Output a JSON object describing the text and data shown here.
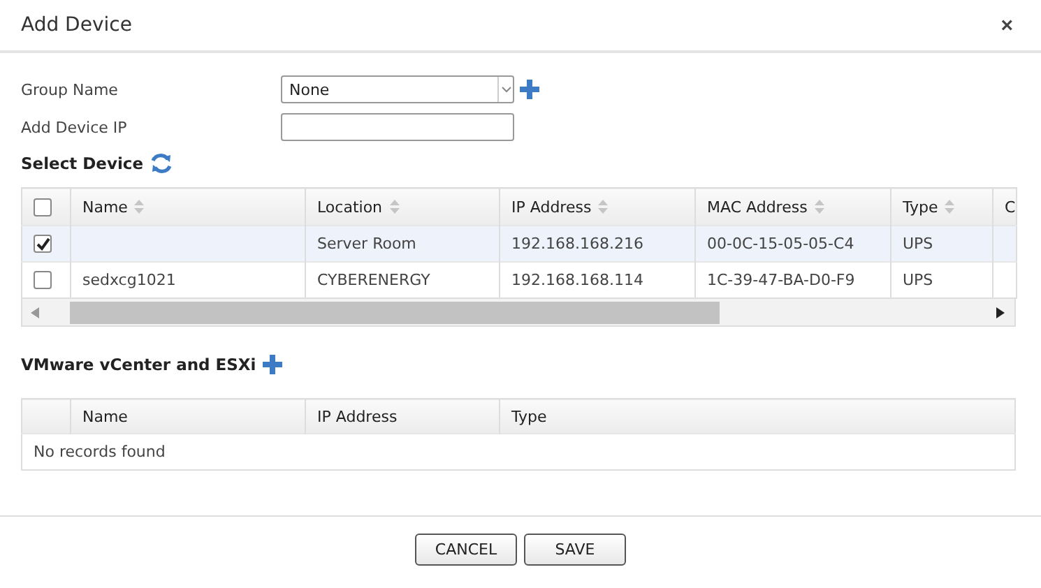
{
  "window": {
    "title": "Add Device",
    "close": "×"
  },
  "form": {
    "group_name": {
      "label": "Group Name",
      "value": "None"
    },
    "device_ip": {
      "label": "Add Device IP"
    }
  },
  "select_device": {
    "title": "Select Device",
    "columns": [
      {
        "label": "Name",
        "sortable": true
      },
      {
        "label": "Location",
        "sortable": true
      },
      {
        "label": "IP Address",
        "sortable": true
      },
      {
        "label": "MAC Address",
        "sortable": true
      },
      {
        "label": "Type",
        "sortable": true
      },
      {
        "label": "C"
      }
    ],
    "header_checked": false,
    "rows": [
      {
        "checked": true,
        "selected": true,
        "cells": [
          "",
          "Server Room",
          "192.168.168.216",
          "00-0C-15-05-05-C4",
          "UPS",
          ""
        ]
      },
      {
        "checked": false,
        "selected": false,
        "cells": [
          "sedxcg1021",
          "CYBERENERGY",
          "192.168.168.114",
          "1C-39-47-BA-D0-F9",
          "UPS",
          ""
        ]
      }
    ]
  },
  "vmware": {
    "title": "VMware vCenter and ESXi",
    "columns": [
      "Name",
      "IP Address",
      "Type"
    ],
    "empty": "No records found"
  },
  "buttons": [
    "CANCEL",
    "SAVE"
  ]
}
